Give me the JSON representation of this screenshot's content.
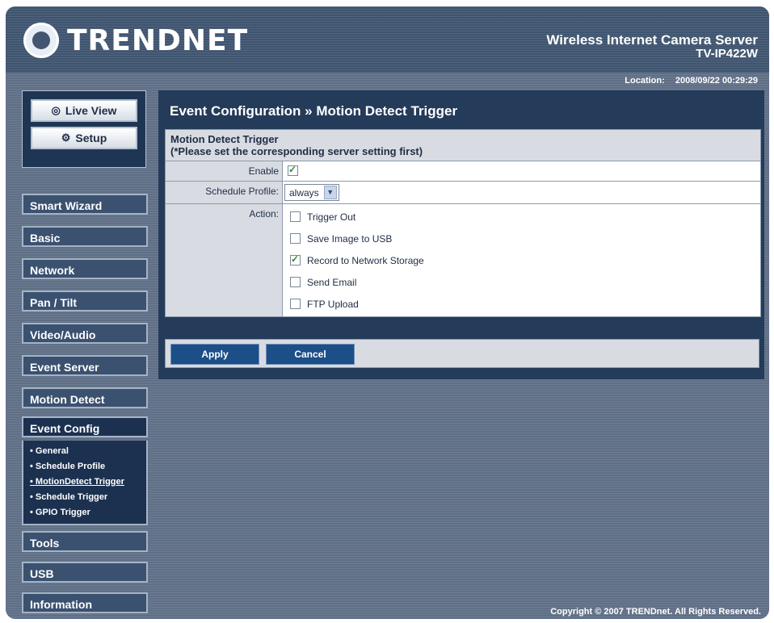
{
  "header": {
    "brand": "TRENDNET",
    "product": "Wireless Internet Camera Server",
    "model": "TV-IP422W",
    "location_label": "Location:",
    "datetime": "2008/09/22 00:29:29"
  },
  "sidebar": {
    "view_buttons": [
      {
        "label": "Live View",
        "icon": "eye-icon"
      },
      {
        "label": "Setup",
        "icon": "gear-icon"
      }
    ],
    "menu": [
      {
        "label": "Smart Wizard"
      },
      {
        "label": "Basic"
      },
      {
        "label": "Network"
      },
      {
        "label": "Pan / Tilt"
      },
      {
        "label": "Video/Audio"
      },
      {
        "label": "Event Server"
      },
      {
        "label": "Motion Detect"
      },
      {
        "label": "Event Config"
      },
      {
        "label": "Tools"
      },
      {
        "label": "USB"
      },
      {
        "label": "Information"
      }
    ],
    "submenu": [
      {
        "label": "General"
      },
      {
        "label": "Schedule Profile"
      },
      {
        "label": "MotionDetect Trigger"
      },
      {
        "label": "Schedule Trigger"
      },
      {
        "label": "GPIO Trigger"
      }
    ]
  },
  "content": {
    "title": "Event Configuration » Motion Detect Trigger",
    "panel_title": "Motion Detect Trigger",
    "panel_subtitle": "(*Please set the corresponding server setting first)",
    "enable": {
      "label": "Enable",
      "checked": true
    },
    "schedule": {
      "label": "Schedule Profile:",
      "selected": "always"
    },
    "action": {
      "label": "Action:",
      "options": [
        {
          "label": "Trigger Out",
          "checked": false
        },
        {
          "label": "Save Image to USB",
          "checked": false
        },
        {
          "label": "Record to Network Storage",
          "checked": true
        },
        {
          "label": "Send Email",
          "checked": false
        },
        {
          "label": "FTP Upload",
          "checked": false
        }
      ]
    },
    "buttons": {
      "apply": "Apply",
      "cancel": "Cancel"
    }
  },
  "footer": {
    "copyright": "Copyright © 2007 TRENDnet. All Rights Reserved."
  },
  "colors": {
    "background": "#5f6f86",
    "panel_dark": "#243b5a",
    "menu": "#3b5170",
    "accent_green": "#2d8a2d",
    "button_blue": "#1c4e88"
  }
}
